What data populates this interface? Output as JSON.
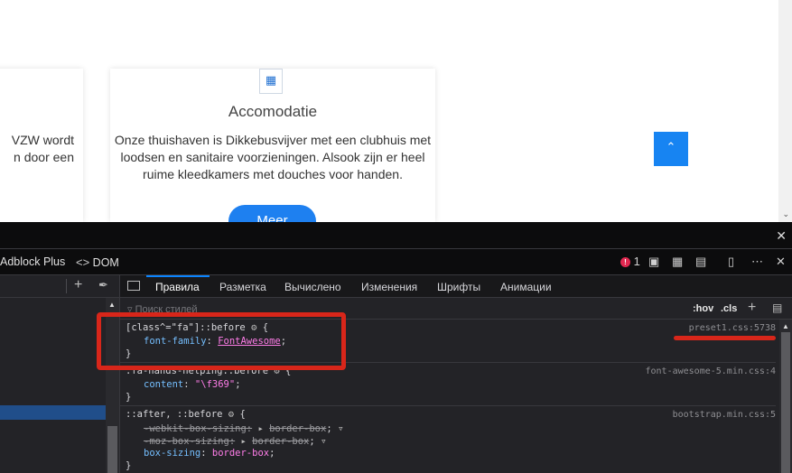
{
  "website": {
    "left_card_text": "VZW wordt\nn door een",
    "card": {
      "icon": "building-icon",
      "title": "Accomodatie",
      "text": "Onze thuishaven is Dikkebusvijver met een clubhuis met loodsen en sanitaire voorzieningen. Alsook zijn er heel ruime kleedkamers met douches voor handen.",
      "button_label": "Meer"
    },
    "back_to_top_icon": "chevron-up-icon"
  },
  "devtools": {
    "main_tabs": [
      {
        "label": "Adblock Plus"
      },
      {
        "label": "DOM"
      }
    ],
    "error_count": "1",
    "rules_tabs": [
      {
        "label": "Правила",
        "active": true
      },
      {
        "label": "Разметка"
      },
      {
        "label": "Вычислено"
      },
      {
        "label": "Изменения"
      },
      {
        "label": "Шрифты"
      },
      {
        "label": "Анимации"
      }
    ],
    "filter_placeholder": "Поиск стилей",
    "hov_label": ":hov",
    "cls_label": ".cls",
    "rules": [
      {
        "selector": "[class^=\"fa\"]::before",
        "source": "preset1.css:5738",
        "declarations": [
          {
            "prop": "font-family",
            "value": "FontAwesome",
            "struck": false
          }
        ]
      },
      {
        "selector": ".fa-hands-helping::before",
        "source": "font-awesome-5.min.css:4",
        "declarations": [
          {
            "prop": "content",
            "value": "\"\\f369\"",
            "struck": false
          }
        ]
      },
      {
        "selector": "::after, ::before",
        "source": "bootstrap.min.css:5",
        "declarations": [
          {
            "prop": "-webkit-box-sizing",
            "value": "border-box",
            "struck": true
          },
          {
            "prop": "-moz-box-sizing",
            "value": "border-box",
            "struck": true
          },
          {
            "prop": "box-sizing",
            "value": "border-box",
            "struck": false
          }
        ]
      }
    ],
    "annotation_color": "#d8261a"
  }
}
